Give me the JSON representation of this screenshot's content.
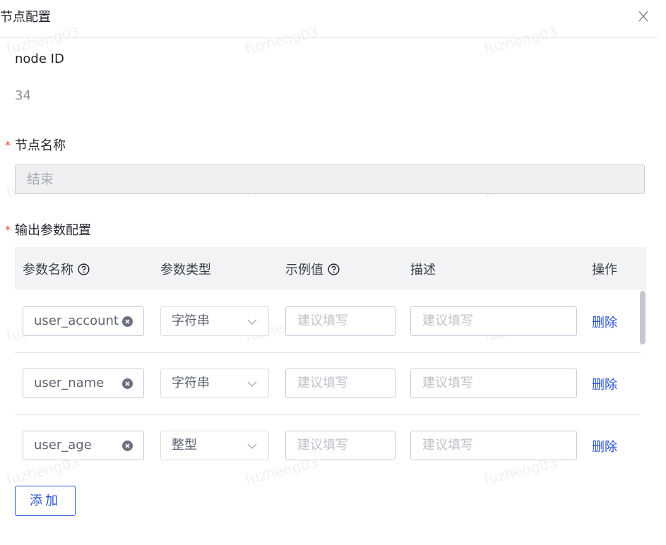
{
  "header": {
    "title": "节点配置",
    "close_label": "X"
  },
  "watermark_text": "fuzheng03",
  "node_id": {
    "label": "node ID",
    "value": "34"
  },
  "node_name": {
    "required_mark": "*",
    "label": "节点名称",
    "value": "结束"
  },
  "output_params": {
    "required_mark": "*",
    "label": "输出参数配置",
    "columns": [
      "参数名称",
      "参数类型",
      "示例值",
      "描述",
      "操作"
    ],
    "rows": [
      {
        "name": "user_account",
        "type": "字符串",
        "example_placeholder": "建议填写",
        "desc_placeholder": "建议填写",
        "action": "删除"
      },
      {
        "name": "user_name",
        "type": "字符串",
        "example_placeholder": "建议填写",
        "desc_placeholder": "建议填写",
        "action": "删除"
      },
      {
        "name": "user_age",
        "type": "整型",
        "example_placeholder": "建议填写",
        "desc_placeholder": "建议填写",
        "action": "删除"
      }
    ],
    "add_label": "添加"
  },
  "colors": {
    "accent": "#2a55d8",
    "required": "#f0443d"
  },
  "icons": [
    "close-icon",
    "help-circle-icon",
    "clear-icon",
    "chevron-down-icon"
  ]
}
